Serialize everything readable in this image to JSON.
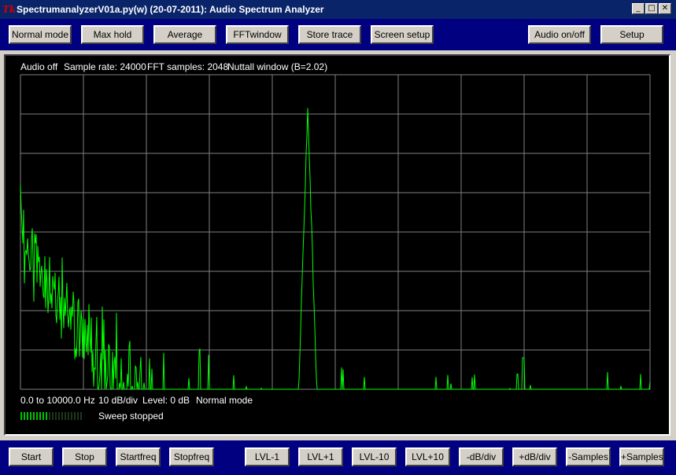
{
  "window": {
    "title": "SpectrumanalyzerV01a.py(w) (20-07-2011): Audio Spectrum Analyzer",
    "icon": "tk-icon",
    "controls": [
      "minimize",
      "maximize",
      "close"
    ]
  },
  "top_toolbar": {
    "buttons": [
      "Normal mode",
      "Max hold",
      "Average",
      "FFTwindow",
      "Store trace",
      "Screen setup",
      "Audio on/off",
      "Setup"
    ]
  },
  "display": {
    "status_line": [
      "Audio off",
      "Sample rate: 24000",
      "FFT samples: 2048",
      "Nuttall window (B=2.02)"
    ],
    "bottom_line": [
      "0.0 to 10000.0 Hz",
      "10 dB/div",
      "Level: 0 dB",
      "Normal mode"
    ],
    "sweep_status": "Sweep stopped",
    "colors": {
      "background": "#000000",
      "grid": "#808080",
      "trace": "#00ff00",
      "text": "#ffffff"
    }
  },
  "bottom_toolbar": {
    "buttons": [
      "Start",
      "Stop",
      "Startfreq",
      "Stopfreq",
      "LVL-1",
      "LVL+1",
      "LVL-10",
      "LVL+10",
      "-dB/div",
      "+dB/div",
      "-Samples",
      "+Samples"
    ]
  },
  "chart_data": {
    "type": "line",
    "x_range": [
      0,
      10000
    ],
    "y_range": [
      -80,
      0
    ],
    "grid": true,
    "peaks": [
      {
        "x": 0,
        "y": -38
      },
      {
        "x": 4563,
        "y": -7
      },
      {
        "x": 7988,
        "y": -72
      }
    ]
  }
}
